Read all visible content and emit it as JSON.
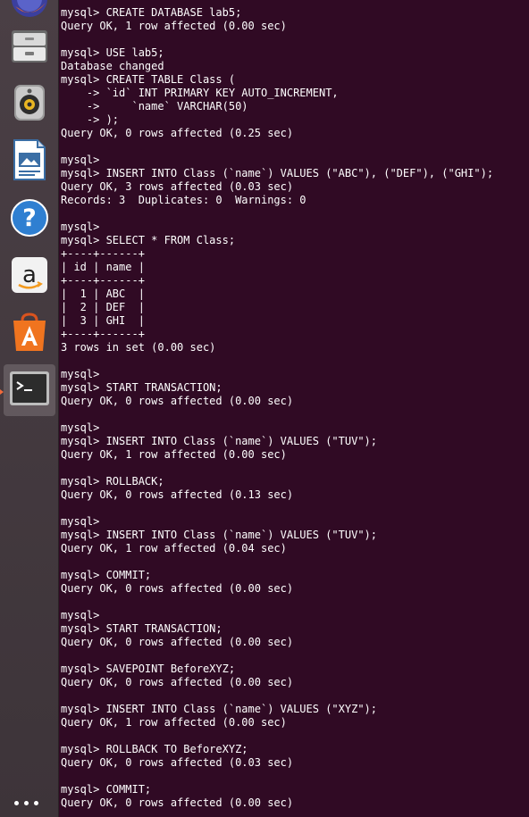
{
  "launcher": {
    "items": [
      {
        "name": "firefox-icon"
      },
      {
        "name": "files-icon"
      },
      {
        "name": "rhythmbox-icon"
      },
      {
        "name": "libreoffice-impress-icon"
      },
      {
        "name": "help-icon"
      },
      {
        "name": "amazon-icon"
      },
      {
        "name": "software-center-icon"
      },
      {
        "name": "terminal-icon",
        "active": true
      }
    ],
    "accent_color": "#f16a3b"
  },
  "terminal": {
    "background": "#300a24",
    "foreground": "#ffffff",
    "lines": [
      "mysql> CREATE DATABASE lab5;",
      "Query OK, 1 row affected (0.00 sec)",
      "",
      "mysql> USE lab5;",
      "Database changed",
      "mysql> CREATE TABLE Class (",
      "    -> `id` INT PRIMARY KEY AUTO_INCREMENT,",
      "    ->     `name` VARCHAR(50)",
      "    -> );",
      "Query OK, 0 rows affected (0.25 sec)",
      "",
      "mysql>",
      "mysql> INSERT INTO Class (`name`) VALUES (\"ABC\"), (\"DEF\"), (\"GHI\");",
      "Query OK, 3 rows affected (0.03 sec)",
      "Records: 3  Duplicates: 0  Warnings: 0",
      "",
      "mysql>",
      "mysql> SELECT * FROM Class;",
      "+----+------+",
      "| id | name |",
      "+----+------+",
      "|  1 | ABC  |",
      "|  2 | DEF  |",
      "|  3 | GHI  |",
      "+----+------+",
      "3 rows in set (0.00 sec)",
      "",
      "mysql>",
      "mysql> START TRANSACTION;",
      "Query OK, 0 rows affected (0.00 sec)",
      "",
      "mysql>",
      "mysql> INSERT INTO Class (`name`) VALUES (\"TUV\");",
      "Query OK, 1 row affected (0.00 sec)",
      "",
      "mysql> ROLLBACK;",
      "Query OK, 0 rows affected (0.13 sec)",
      "",
      "mysql>",
      "mysql> INSERT INTO Class (`name`) VALUES (\"TUV\");",
      "Query OK, 1 row affected (0.04 sec)",
      "",
      "mysql> COMMIT;",
      "Query OK, 0 rows affected (0.00 sec)",
      "",
      "mysql>",
      "mysql> START TRANSACTION;",
      "Query OK, 0 rows affected (0.00 sec)",
      "",
      "mysql> SAVEPOINT BeforeXYZ;",
      "Query OK, 0 rows affected (0.00 sec)",
      "",
      "mysql> INSERT INTO Class (`name`) VALUES (\"XYZ\");",
      "Query OK, 1 row affected (0.00 sec)",
      "",
      "mysql> ROLLBACK TO BeforeXYZ;",
      "Query OK, 0 rows affected (0.03 sec)",
      "",
      "mysql> COMMIT;",
      "Query OK, 0 rows affected (0.00 sec)"
    ]
  }
}
